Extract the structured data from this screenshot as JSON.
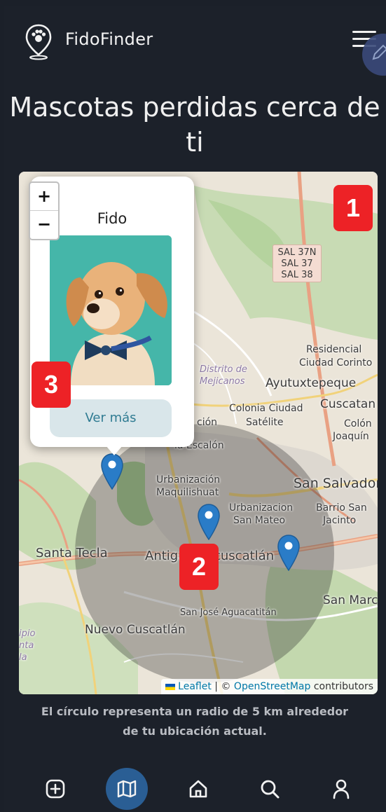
{
  "app": {
    "name": "FidoFinder"
  },
  "header": {
    "title": "Mascotas perdidas cerca de ti"
  },
  "map": {
    "labels": [
      "SAL 37N",
      "SAL 37",
      "SAL 38",
      "Residencial",
      "Ciudad Corinto",
      "Distrito de",
      "Mejicanos",
      "Ayutuxtepeque",
      "Cuscatan",
      "Colonia Ciudad",
      "Satélite",
      "Colón",
      "Joaquín",
      "ción",
      "la Escalón",
      "Urbanización",
      "Maquilishuat",
      "San Salvador",
      "Urbanizacion",
      "San Mateo",
      "Barrio San",
      "Jacinto",
      "Santa Tecla",
      "Antigu",
      "cuscatlán",
      "San Marc",
      "San José Aguacatitán",
      "Nuevo Cuscatlán",
      "ipio",
      "nta",
      "la"
    ],
    "zoom_in": "+",
    "zoom_out": "−",
    "attribution": {
      "leaflet": "Leaflet",
      "sep": "| ©",
      "osm": "OpenStreetMap",
      "suffix": "contributors"
    },
    "radius_color": "#3a3a3a",
    "marker_color": "#2a7cc7"
  },
  "popup": {
    "pet_name": "Fido",
    "button_label": "Ver más"
  },
  "callouts": [
    "1",
    "2",
    "3"
  ],
  "caption": "El círculo representa un radio de 5 km alrededor de tu ubicación actual.",
  "nav": {
    "items": [
      {
        "icon": "add-icon",
        "active": false
      },
      {
        "icon": "map-icon",
        "active": true
      },
      {
        "icon": "home-icon",
        "active": false
      },
      {
        "icon": "search-icon",
        "active": false
      },
      {
        "icon": "user-icon",
        "active": false
      }
    ]
  },
  "colors": {
    "background": "#1c212a",
    "accent": "#2a5e94",
    "callout": "#ed2226",
    "button": "#d9e6ea"
  }
}
